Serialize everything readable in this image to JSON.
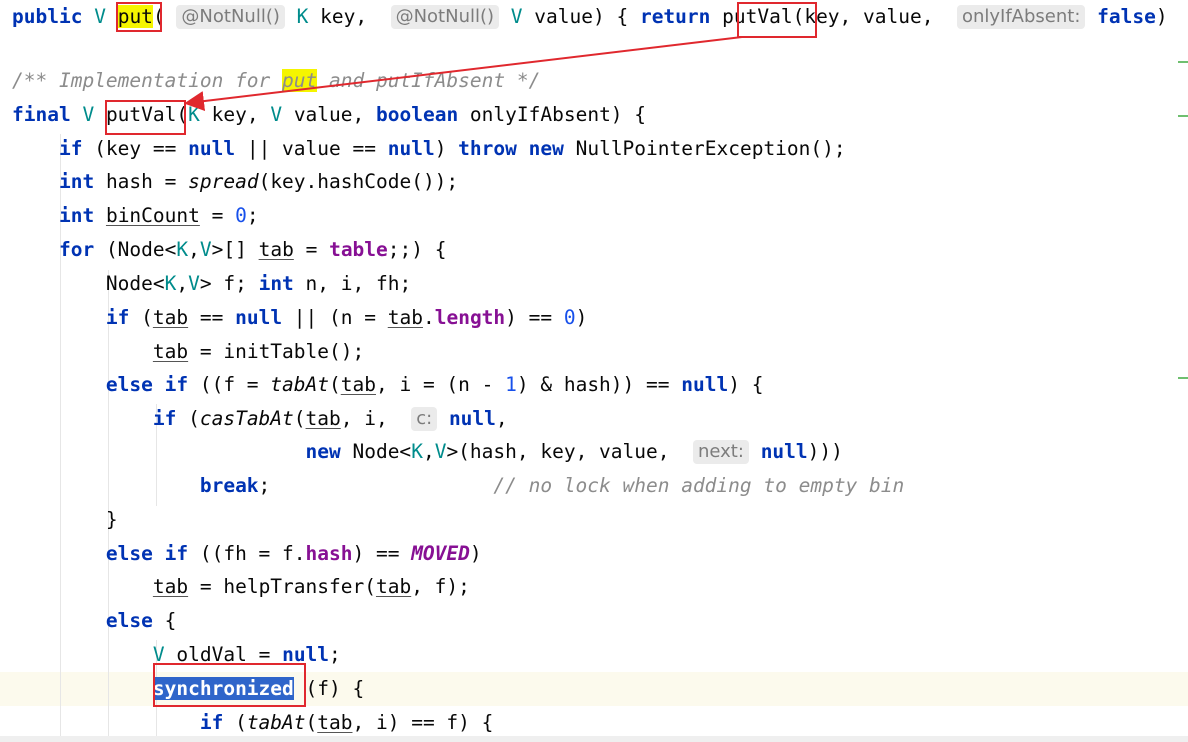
{
  "editor": {
    "lines": [
      {
        "id": "put-signature",
        "tokens": [
          {
            "t": "public",
            "c": "kw"
          },
          {
            "t": " "
          },
          {
            "t": "V",
            "c": "tp"
          },
          {
            "t": " "
          },
          {
            "t": "put",
            "c": "ybg"
          },
          {
            "t": "( "
          },
          {
            "t": "@NotNull()",
            "c": "hint"
          },
          {
            "t": " "
          },
          {
            "t": "K",
            "c": "tp"
          },
          {
            "t": " key,  "
          },
          {
            "t": "@NotNull()",
            "c": "hint"
          },
          {
            "t": " "
          },
          {
            "t": "V",
            "c": "tp"
          },
          {
            "t": " value) { "
          },
          {
            "t": "return",
            "c": "kw"
          },
          {
            "t": " putVal(key, value,  "
          },
          {
            "t": "onlyIfAbsent:",
            "c": "hint"
          },
          {
            "t": " "
          },
          {
            "t": "false",
            "c": "kw"
          },
          {
            "t": ")"
          }
        ]
      },
      {
        "id": "blank-1",
        "tokens": []
      },
      {
        "id": "javadoc",
        "tokens": [
          {
            "t": "/** Implementation for ",
            "c": "cm"
          },
          {
            "t": "put",
            "c": "cm ybg"
          },
          {
            "t": " and putIfAbsent */",
            "c": "cm"
          }
        ]
      },
      {
        "id": "putval-signature",
        "tokens": [
          {
            "t": "final",
            "c": "kw"
          },
          {
            "t": " "
          },
          {
            "t": "V",
            "c": "tp"
          },
          {
            "t": " putVal("
          },
          {
            "t": "K",
            "c": "tp"
          },
          {
            "t": " key, "
          },
          {
            "t": "V",
            "c": "tp"
          },
          {
            "t": " value, "
          },
          {
            "t": "boolean",
            "c": "kw"
          },
          {
            "t": " onlyIfAbsent) {"
          }
        ]
      },
      {
        "id": "null-check",
        "tokens": [
          {
            "t": "    "
          },
          {
            "t": "if",
            "c": "kw"
          },
          {
            "t": " (key == "
          },
          {
            "t": "null",
            "c": "kw"
          },
          {
            "t": " || value == "
          },
          {
            "t": "null",
            "c": "kw"
          },
          {
            "t": ") "
          },
          {
            "t": "throw",
            "c": "kw"
          },
          {
            "t": " "
          },
          {
            "t": "new",
            "c": "kw"
          },
          {
            "t": " NullPointerException();"
          }
        ]
      },
      {
        "id": "hash",
        "tokens": [
          {
            "t": "    "
          },
          {
            "t": "int",
            "c": "kw"
          },
          {
            "t": " hash = "
          },
          {
            "t": "spread",
            "c": "it"
          },
          {
            "t": "(key.hashCode());"
          }
        ]
      },
      {
        "id": "bincount",
        "tokens": [
          {
            "t": "    "
          },
          {
            "t": "int",
            "c": "kw"
          },
          {
            "t": " "
          },
          {
            "t": "binCount",
            "c": "ul"
          },
          {
            "t": " = "
          },
          {
            "t": "0",
            "c": "num"
          },
          {
            "t": ";"
          }
        ]
      },
      {
        "id": "for-loop",
        "tokens": [
          {
            "t": "    "
          },
          {
            "t": "for",
            "c": "kw"
          },
          {
            "t": " (Node<"
          },
          {
            "t": "K",
            "c": "tp"
          },
          {
            "t": ","
          },
          {
            "t": "V",
            "c": "tp"
          },
          {
            "t": ">[] "
          },
          {
            "t": "tab",
            "c": "ul"
          },
          {
            "t": " = "
          },
          {
            "t": "table",
            "c": "fld"
          },
          {
            "t": ";;) {"
          }
        ]
      },
      {
        "id": "node-decl",
        "tokens": [
          {
            "t": "        Node<"
          },
          {
            "t": "K",
            "c": "tp"
          },
          {
            "t": ","
          },
          {
            "t": "V",
            "c": "tp"
          },
          {
            "t": "> f; "
          },
          {
            "t": "int",
            "c": "kw"
          },
          {
            "t": " n, i, fh;"
          }
        ]
      },
      {
        "id": "if-tab-null",
        "tokens": [
          {
            "t": "        "
          },
          {
            "t": "if",
            "c": "kw"
          },
          {
            "t": " ("
          },
          {
            "t": "tab",
            "c": "ul"
          },
          {
            "t": " == "
          },
          {
            "t": "null",
            "c": "kw"
          },
          {
            "t": " || (n = "
          },
          {
            "t": "tab",
            "c": "ul"
          },
          {
            "t": "."
          },
          {
            "t": "length",
            "c": "fld"
          },
          {
            "t": ") == "
          },
          {
            "t": "0",
            "c": "num"
          },
          {
            "t": ")"
          }
        ]
      },
      {
        "id": "init-table",
        "tokens": [
          {
            "t": "            "
          },
          {
            "t": "tab",
            "c": "ul"
          },
          {
            "t": " = initTable();"
          }
        ]
      },
      {
        "id": "else-if-tabat",
        "tokens": [
          {
            "t": "        "
          },
          {
            "t": "else if",
            "c": "kw"
          },
          {
            "t": " ((f = "
          },
          {
            "t": "tabAt",
            "c": "it"
          },
          {
            "t": "("
          },
          {
            "t": "tab",
            "c": "ul"
          },
          {
            "t": ", i = (n - "
          },
          {
            "t": "1",
            "c": "num"
          },
          {
            "t": ") & hash)) == "
          },
          {
            "t": "null",
            "c": "kw"
          },
          {
            "t": ") {"
          }
        ]
      },
      {
        "id": "if-cas",
        "tokens": [
          {
            "t": "            "
          },
          {
            "t": "if",
            "c": "kw"
          },
          {
            "t": " ("
          },
          {
            "t": "casTabAt",
            "c": "it"
          },
          {
            "t": "("
          },
          {
            "t": "tab",
            "c": "ul"
          },
          {
            "t": ", i,  "
          },
          {
            "t": "c:",
            "c": "hint"
          },
          {
            "t": " "
          },
          {
            "t": "null",
            "c": "kw"
          },
          {
            "t": ","
          }
        ]
      },
      {
        "id": "new-node",
        "tokens": [
          {
            "t": "                         "
          },
          {
            "t": "new",
            "c": "kw"
          },
          {
            "t": " Node<"
          },
          {
            "t": "K",
            "c": "tp"
          },
          {
            "t": ","
          },
          {
            "t": "V",
            "c": "tp"
          },
          {
            "t": ">(hash, key, value,  "
          },
          {
            "t": "next:",
            "c": "hint"
          },
          {
            "t": " "
          },
          {
            "t": "null",
            "c": "kw"
          },
          {
            "t": ")))"
          }
        ]
      },
      {
        "id": "break",
        "tokens": [
          {
            "t": "                "
          },
          {
            "t": "break",
            "c": "kw"
          },
          {
            "t": ";                   "
          },
          {
            "t": "// no lock when adding to empty bin",
            "c": "cm"
          }
        ]
      },
      {
        "id": "close-brace",
        "tokens": [
          {
            "t": "        }"
          }
        ]
      },
      {
        "id": "else-if-moved",
        "tokens": [
          {
            "t": "        "
          },
          {
            "t": "else if",
            "c": "kw"
          },
          {
            "t": " ((fh = f."
          },
          {
            "t": "hash",
            "c": "fld"
          },
          {
            "t": ") == "
          },
          {
            "t": "MOVED",
            "c": "cst"
          },
          {
            "t": ")"
          }
        ]
      },
      {
        "id": "help-transfer",
        "tokens": [
          {
            "t": "            "
          },
          {
            "t": "tab",
            "c": "ul"
          },
          {
            "t": " = helpTransfer("
          },
          {
            "t": "tab",
            "c": "ul"
          },
          {
            "t": ", f);"
          }
        ]
      },
      {
        "id": "else",
        "tokens": [
          {
            "t": "        "
          },
          {
            "t": "else",
            "c": "kw"
          },
          {
            "t": " {"
          }
        ]
      },
      {
        "id": "oldval",
        "tokens": [
          {
            "t": "            "
          },
          {
            "t": "V",
            "c": "tp"
          },
          {
            "t": " "
          },
          {
            "t": "oldVal",
            "c": "ul"
          },
          {
            "t": " = "
          },
          {
            "t": "null",
            "c": "kw"
          },
          {
            "t": ";"
          }
        ]
      },
      {
        "id": "synchronized",
        "tokens": [
          {
            "t": "            "
          },
          {
            "t": "synchronized",
            "c": "kw sel"
          },
          {
            "t": " (f) {"
          }
        ]
      },
      {
        "id": "if-tabat-eq",
        "tokens": [
          {
            "t": "                "
          },
          {
            "t": "if",
            "c": "kw"
          },
          {
            "t": " ("
          },
          {
            "t": "tabAt",
            "c": "it"
          },
          {
            "t": "("
          },
          {
            "t": "tab",
            "c": "ul"
          },
          {
            "t": ", i) == f) {"
          }
        ]
      }
    ]
  }
}
